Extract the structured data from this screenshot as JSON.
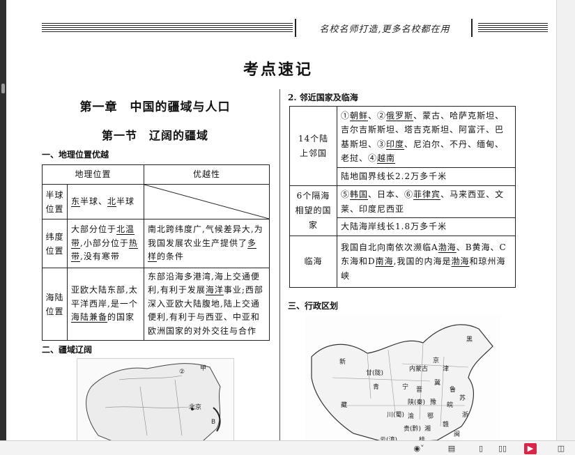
{
  "header": {
    "slogan": "名校名师打造,更多名校都在用"
  },
  "page_title": "考点速记",
  "chapter": {
    "title": "第一章　中国的疆域与人口",
    "section": "第一节　辽阔的疆域"
  },
  "part1": {
    "heading": "一、地理位置优越",
    "table": {
      "col1": "地理位置",
      "col2": "优越性",
      "rows": [
        {
          "head": "半球位置",
          "pos_parts": [
            "东",
            "半球、",
            "北",
            "半球"
          ]
        },
        {
          "head": "纬度位置",
          "pos_parts": [
            "大部分位于",
            "北温带",
            ",小部分位于",
            "热带",
            ",没有寒带"
          ],
          "adv_parts": [
            "南北跨纬度广,气候差异大,为我国发展农业生产提供了",
            "多样",
            "的条件"
          ]
        },
        {
          "head": "海陆位置",
          "pos_parts": [
            "亚欧大陆东部,太平洋西岸,是一个",
            "海陆兼备",
            "的国家"
          ],
          "adv_parts": [
            "东部沿海多港湾,海上交通便利,有利于发展",
            "海洋",
            "事业;西部深入亚欧大陆腹地,陆上交通便利,有利于与西亚、中亚和欧洲国家的对外交往与合作"
          ]
        }
      ]
    }
  },
  "part2": {
    "heading": "二、疆域辽阔",
    "map_labels": {
      "a": "甲",
      "two": "②",
      "b": "B",
      "beijing": "北京"
    }
  },
  "neighbors": {
    "heading": "2. 邻近国家及临海",
    "rows": [
      {
        "head": "14个陆上邻国",
        "parts": [
          "①",
          "朝鲜",
          "、②",
          "俄罗斯",
          "、蒙古、哈萨克斯坦、吉尔吉斯斯坦、塔吉克斯坦、阿富汗、巴基斯坦、③",
          "印度",
          "、尼泊尔、不丹、缅甸、老挝、④",
          "越南"
        ],
        "extra": "陆地国界线长2.2万多千米"
      },
      {
        "head": "6个隔海相望的国家",
        "parts": [
          "⑤",
          "韩国",
          "、日本、⑥",
          "菲律宾",
          "、马来西亚、文莱、印度尼西亚"
        ],
        "extra": "大陆海岸线长1.8万多千米"
      },
      {
        "head": "临海",
        "parts": [
          "我国自北向南依次濒临A",
          "渤海",
          "、B黄海、C东海和D",
          "南海",
          ",我国的内海是",
          "渤海",
          "和琼州海峡"
        ]
      }
    ]
  },
  "part3": {
    "heading": "三、行政区划",
    "map_labels": [
      "黑",
      "新",
      "甘(陇)",
      "内蒙古",
      "京",
      "津",
      "冀",
      "宁",
      "晋",
      "鲁",
      "青",
      "陕(秦)",
      "豫",
      "藏",
      "川(蜀)",
      "渝",
      "鄂",
      "皖",
      "苏",
      "贵(黔)",
      "湘",
      "赣",
      "浙",
      "云(滇)",
      "桂",
      "闽"
    ]
  },
  "toolbar": {
    "zoom_icon": "eye-icon",
    "buttons": [
      "single-page",
      "two-page",
      "present",
      "bookmark"
    ]
  },
  "colors": {
    "accent_red": "#d6274b",
    "ink": "#111111"
  }
}
